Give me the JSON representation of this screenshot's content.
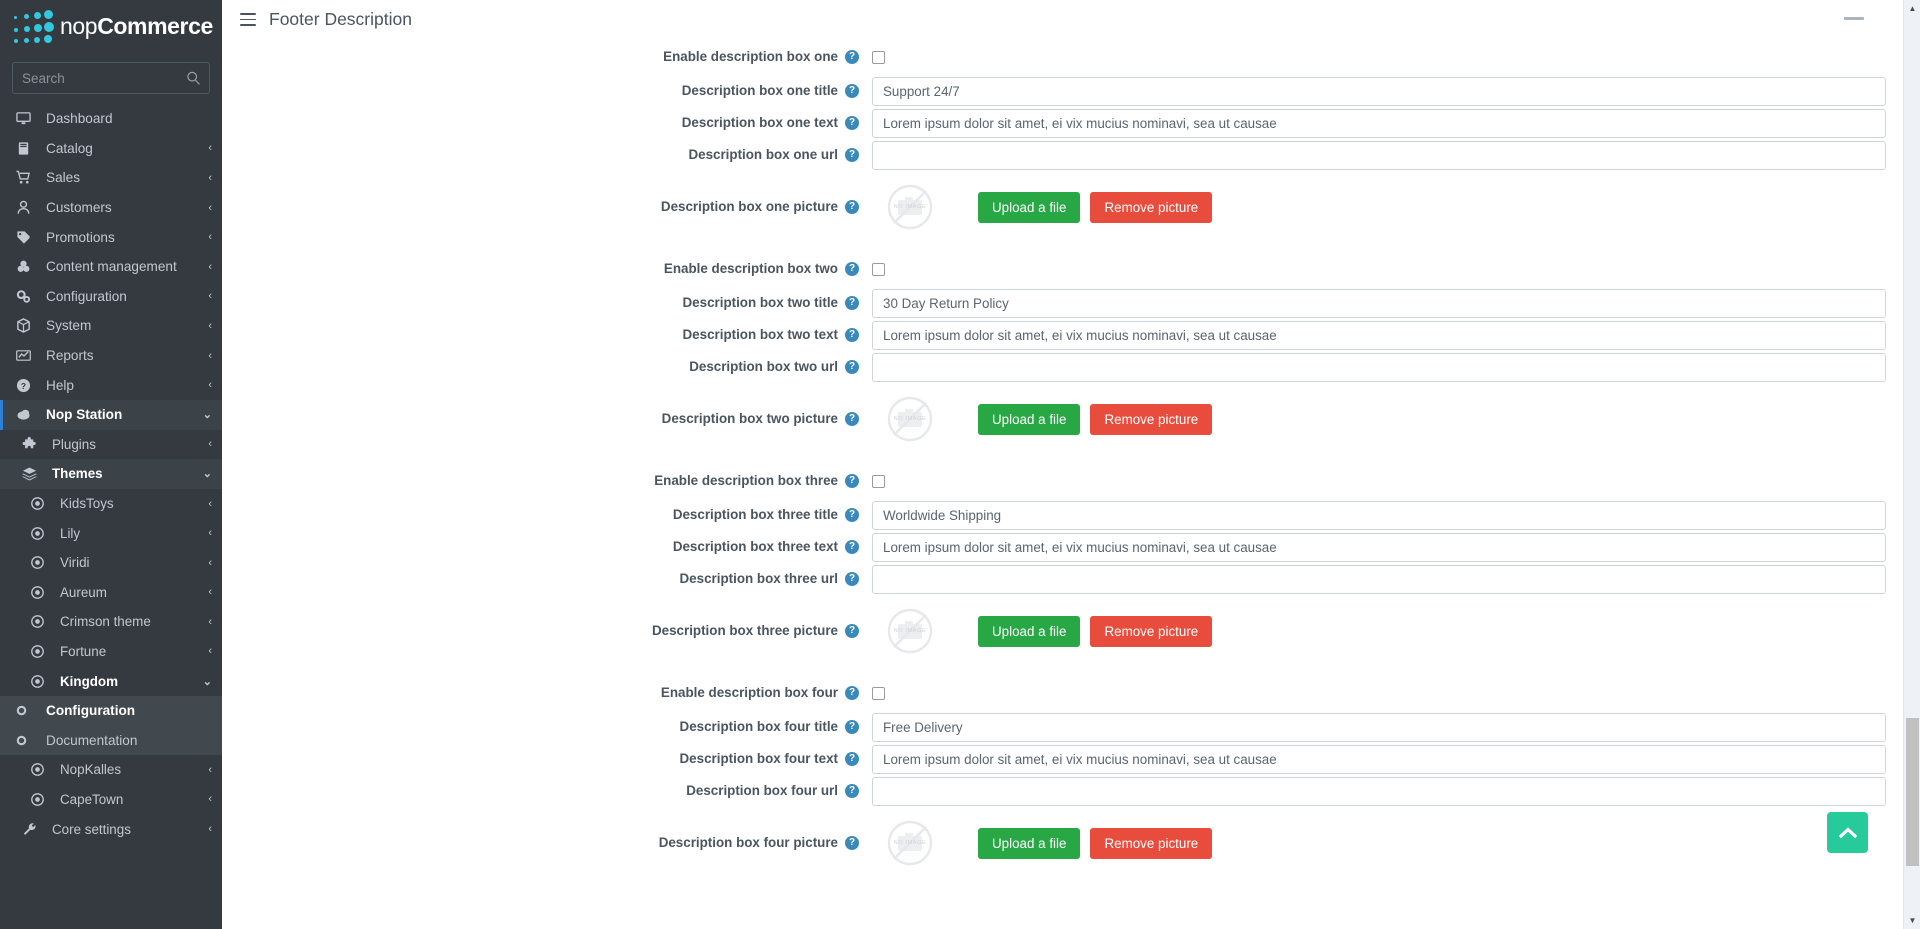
{
  "brand": {
    "light": "nop",
    "bold": "Commerce",
    "logo_icon": "dot-grid-logo"
  },
  "search": {
    "placeholder": "Search",
    "value": "",
    "icon": "search-icon"
  },
  "sidebar": {
    "items": [
      {
        "label": "Dashboard",
        "icon": "monitor-icon",
        "level": 1,
        "caret": "",
        "state": ""
      },
      {
        "label": "Catalog",
        "icon": "book-icon",
        "level": 1,
        "caret": "‹",
        "state": ""
      },
      {
        "label": "Sales",
        "icon": "cart-icon",
        "level": 1,
        "caret": "‹",
        "state": ""
      },
      {
        "label": "Customers",
        "icon": "user-icon",
        "level": 1,
        "caret": "‹",
        "state": ""
      },
      {
        "label": "Promotions",
        "icon": "tag-icon",
        "level": 1,
        "caret": "‹",
        "state": ""
      },
      {
        "label": "Content management",
        "icon": "cubes-icon",
        "level": 1,
        "caret": "‹",
        "state": ""
      },
      {
        "label": "Configuration",
        "icon": "cogs-icon",
        "level": 1,
        "caret": "‹",
        "state": ""
      },
      {
        "label": "System",
        "icon": "box-icon",
        "level": 1,
        "caret": "‹",
        "state": ""
      },
      {
        "label": "Reports",
        "icon": "chart-icon",
        "level": 1,
        "caret": "‹",
        "state": ""
      },
      {
        "label": "Help",
        "icon": "question-icon",
        "level": 1,
        "caret": "‹",
        "state": ""
      },
      {
        "label": "Nop Station",
        "icon": "cloud-icon",
        "level": 1,
        "caret": "⌄",
        "state": "active-top"
      },
      {
        "label": "Plugins",
        "icon": "puzzle-icon",
        "level": 2,
        "caret": "‹",
        "state": ""
      },
      {
        "label": "Themes",
        "icon": "layers-icon",
        "level": 2,
        "caret": "⌄",
        "state": "open-branch"
      },
      {
        "label": "KidsToys",
        "icon": "radio-icon",
        "level": 3,
        "caret": "‹",
        "state": ""
      },
      {
        "label": "Lily",
        "icon": "radio-icon",
        "level": 3,
        "caret": "‹",
        "state": ""
      },
      {
        "label": "Viridi",
        "icon": "radio-icon",
        "level": 3,
        "caret": "‹",
        "state": ""
      },
      {
        "label": "Aureum",
        "icon": "radio-icon",
        "level": 3,
        "caret": "‹",
        "state": ""
      },
      {
        "label": "Crimson theme",
        "icon": "radio-icon",
        "level": 3,
        "caret": "‹",
        "state": ""
      },
      {
        "label": "Fortune",
        "icon": "radio-icon",
        "level": 3,
        "caret": "‹",
        "state": ""
      },
      {
        "label": "Kingdom",
        "icon": "radio-icon",
        "level": 3,
        "caret": "⌄",
        "state": "bold-white"
      },
      {
        "label": "Configuration",
        "icon": "dot-icon",
        "level": 4,
        "caret": "",
        "state": "sub-bg sel"
      },
      {
        "label": "Documentation",
        "icon": "dot-icon",
        "level": 4,
        "caret": "",
        "state": "sub-bg"
      },
      {
        "label": "NopKalles",
        "icon": "radio-icon",
        "level": 3,
        "caret": "‹",
        "state": ""
      },
      {
        "label": "CapeTown",
        "icon": "radio-icon",
        "level": 3,
        "caret": "‹",
        "state": ""
      },
      {
        "label": "Core settings",
        "icon": "wrench-icon",
        "level": 2,
        "caret": "‹",
        "state": ""
      }
    ]
  },
  "topbar": {
    "title": "Footer Description",
    "hamburger_icon": "hamburger-icon",
    "minimize_icon": "minimize-icon"
  },
  "help_glyph": "?",
  "picture": {
    "no_image_label": "NO IMAGE",
    "upload_label": "Upload a file",
    "remove_label": "Remove picture",
    "placeholder_icon": "no-image-icon"
  },
  "form": {
    "url_placeholder": "",
    "boxes": [
      {
        "enable_label": "Enable description box one",
        "enable_checked": false,
        "title_label": "Description box one title",
        "title_value": "Support 24/7",
        "text_label": "Description box one text",
        "text_value": "Lorem ipsum dolor sit amet, ei vix mucius nominavi, sea ut causae",
        "url_label": "Description box one url",
        "url_value": "",
        "picture_label": "Description box one picture"
      },
      {
        "enable_label": "Enable description box two",
        "enable_checked": false,
        "title_label": "Description box two title",
        "title_value": "30 Day Return Policy",
        "text_label": "Description box two text",
        "text_value": "Lorem ipsum dolor sit amet, ei vix mucius nominavi, sea ut causae",
        "url_label": "Description box two url",
        "url_value": "",
        "picture_label": "Description box two picture"
      },
      {
        "enable_label": "Enable description box three",
        "enable_checked": false,
        "title_label": "Description box three title",
        "title_value": "Worldwide Shipping",
        "text_label": "Description box three text",
        "text_value": "Lorem ipsum dolor sit amet, ei vix mucius nominavi, sea ut causae",
        "url_label": "Description box three url",
        "url_value": "",
        "picture_label": "Description box three picture"
      },
      {
        "enable_label": "Enable description box four",
        "enable_checked": false,
        "title_label": "Description box four title",
        "title_value": "Free Delivery",
        "text_label": "Description box four text",
        "text_value": "Lorem ipsum dolor sit amet, ei vix mucius nominavi, sea ut causae",
        "url_label": "Description box four url",
        "url_value": "",
        "picture_label": "Description box four picture"
      }
    ]
  },
  "scroll_top": {
    "icon": "chevron-up-icon",
    "color": "#27ca9a"
  },
  "scrollbar": {
    "up_arrow": "▲",
    "down_arrow": "▼"
  },
  "colors": {
    "sidebar_bg": "#343a40",
    "accent_blue": "#2f7fd8",
    "brand_cyan": "#32c8de",
    "upload_green": "#28a745",
    "remove_red": "#e74c3c",
    "scroll_top_green": "#27ca9a",
    "help_blue": "#3a89bd"
  }
}
